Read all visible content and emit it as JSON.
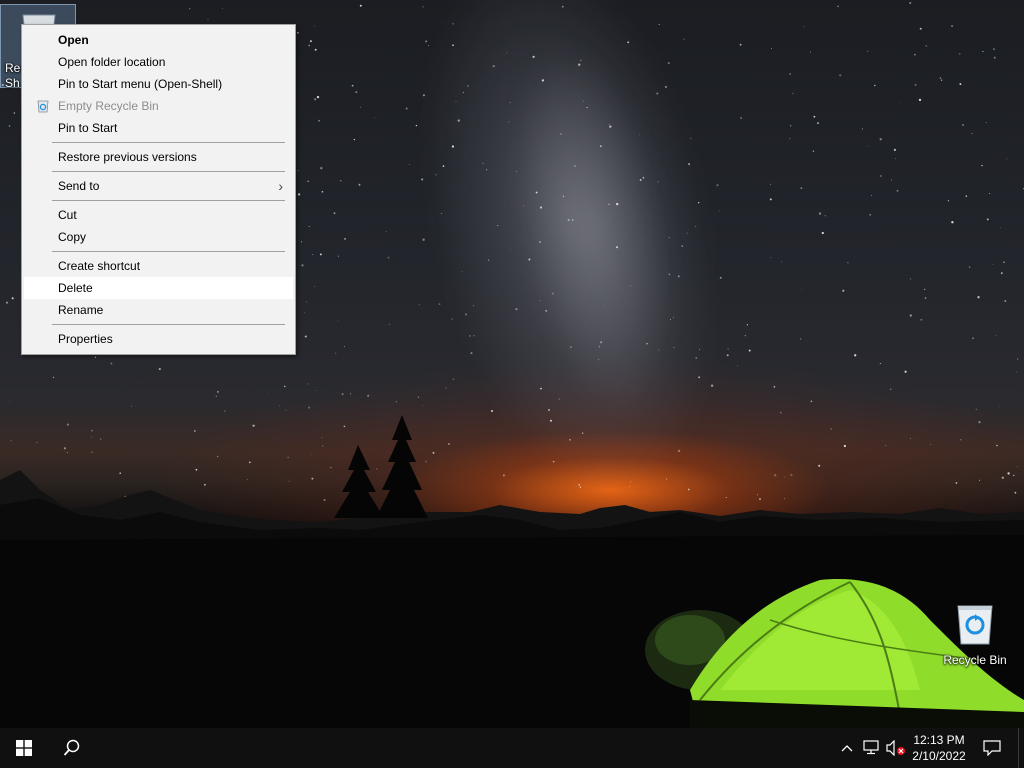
{
  "desktop": {
    "shortcut_icon": {
      "label_line1": "Rec",
      "label_line2": "Sh"
    },
    "recycle_bin": {
      "label": "Recycle Bin"
    }
  },
  "context_menu": {
    "items": [
      {
        "label": "Open",
        "bold": true
      },
      {
        "label": "Open folder location"
      },
      {
        "label": "Pin to Start menu (Open-Shell)"
      },
      {
        "label": "Empty Recycle Bin",
        "disabled": true,
        "icon": "recycle-bin-icon"
      },
      {
        "label": "Pin to Start"
      },
      {
        "label": "Restore previous versions"
      },
      {
        "label": "Send to",
        "submenu": true
      },
      {
        "label": "Cut"
      },
      {
        "label": "Copy"
      },
      {
        "label": "Create shortcut"
      },
      {
        "label": "Delete",
        "highlighted": true
      },
      {
        "label": "Rename"
      },
      {
        "label": "Properties"
      }
    ]
  },
  "taskbar": {
    "start_icon": "windows-logo-icon",
    "search_icon": "search-icon",
    "tray": {
      "chevron_icon": "chevron-up-icon",
      "network_icon": "network-icon",
      "volume_icon": "volume-muted-icon",
      "notification_icon": "notification-icon"
    },
    "clock": {
      "time": "12:13 PM",
      "date": "2/10/2022"
    }
  },
  "colors": {
    "taskbar_bg": "#101010",
    "menu_bg": "#f2f2f2",
    "menu_highlight": "#ffffff",
    "tent_green": "#8fdc2a",
    "horizon_glow": "#ff6e14"
  }
}
